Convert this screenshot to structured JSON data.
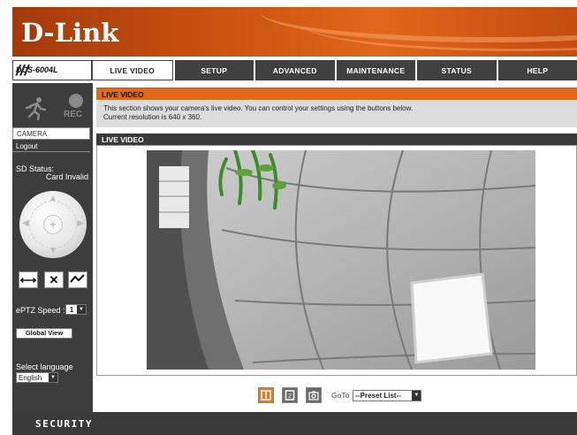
{
  "brand": {
    "logo": "D-Link"
  },
  "model": "DCS-6004L",
  "nav": {
    "tabs": [
      {
        "label": "LIVE VIDEO",
        "active": true
      },
      {
        "label": "SETUP"
      },
      {
        "label": "ADVANCED"
      },
      {
        "label": "MAINTENANCE"
      },
      {
        "label": "STATUS"
      },
      {
        "label": "HELP"
      }
    ]
  },
  "sidebar": {
    "rec_label": "REC",
    "menu": {
      "camera": "CAMERA",
      "logout": "Logout"
    },
    "sd_status_label": "SD Status:",
    "sd_status_value": "Card Invalid",
    "ptz_speed_label": "ePTZ Speed :",
    "ptz_speed_value": "1",
    "global_view_label": "Global View",
    "language_label": "Select language",
    "language_value": "English"
  },
  "main": {
    "section_title": "LIVE VIDEO",
    "description_line1": "This section shows your camera's live video. You can control your settings using the buttons below.",
    "description_line2": "Current resolution is 640 x 360.",
    "video_title": "LIVE VIDEO",
    "goto_label": "GoTo",
    "preset_value": "--Preset List--"
  },
  "footer": {
    "label": "SECURITY"
  },
  "colors": {
    "accent": "#e06a1a",
    "dark": "#3a3a3a"
  }
}
